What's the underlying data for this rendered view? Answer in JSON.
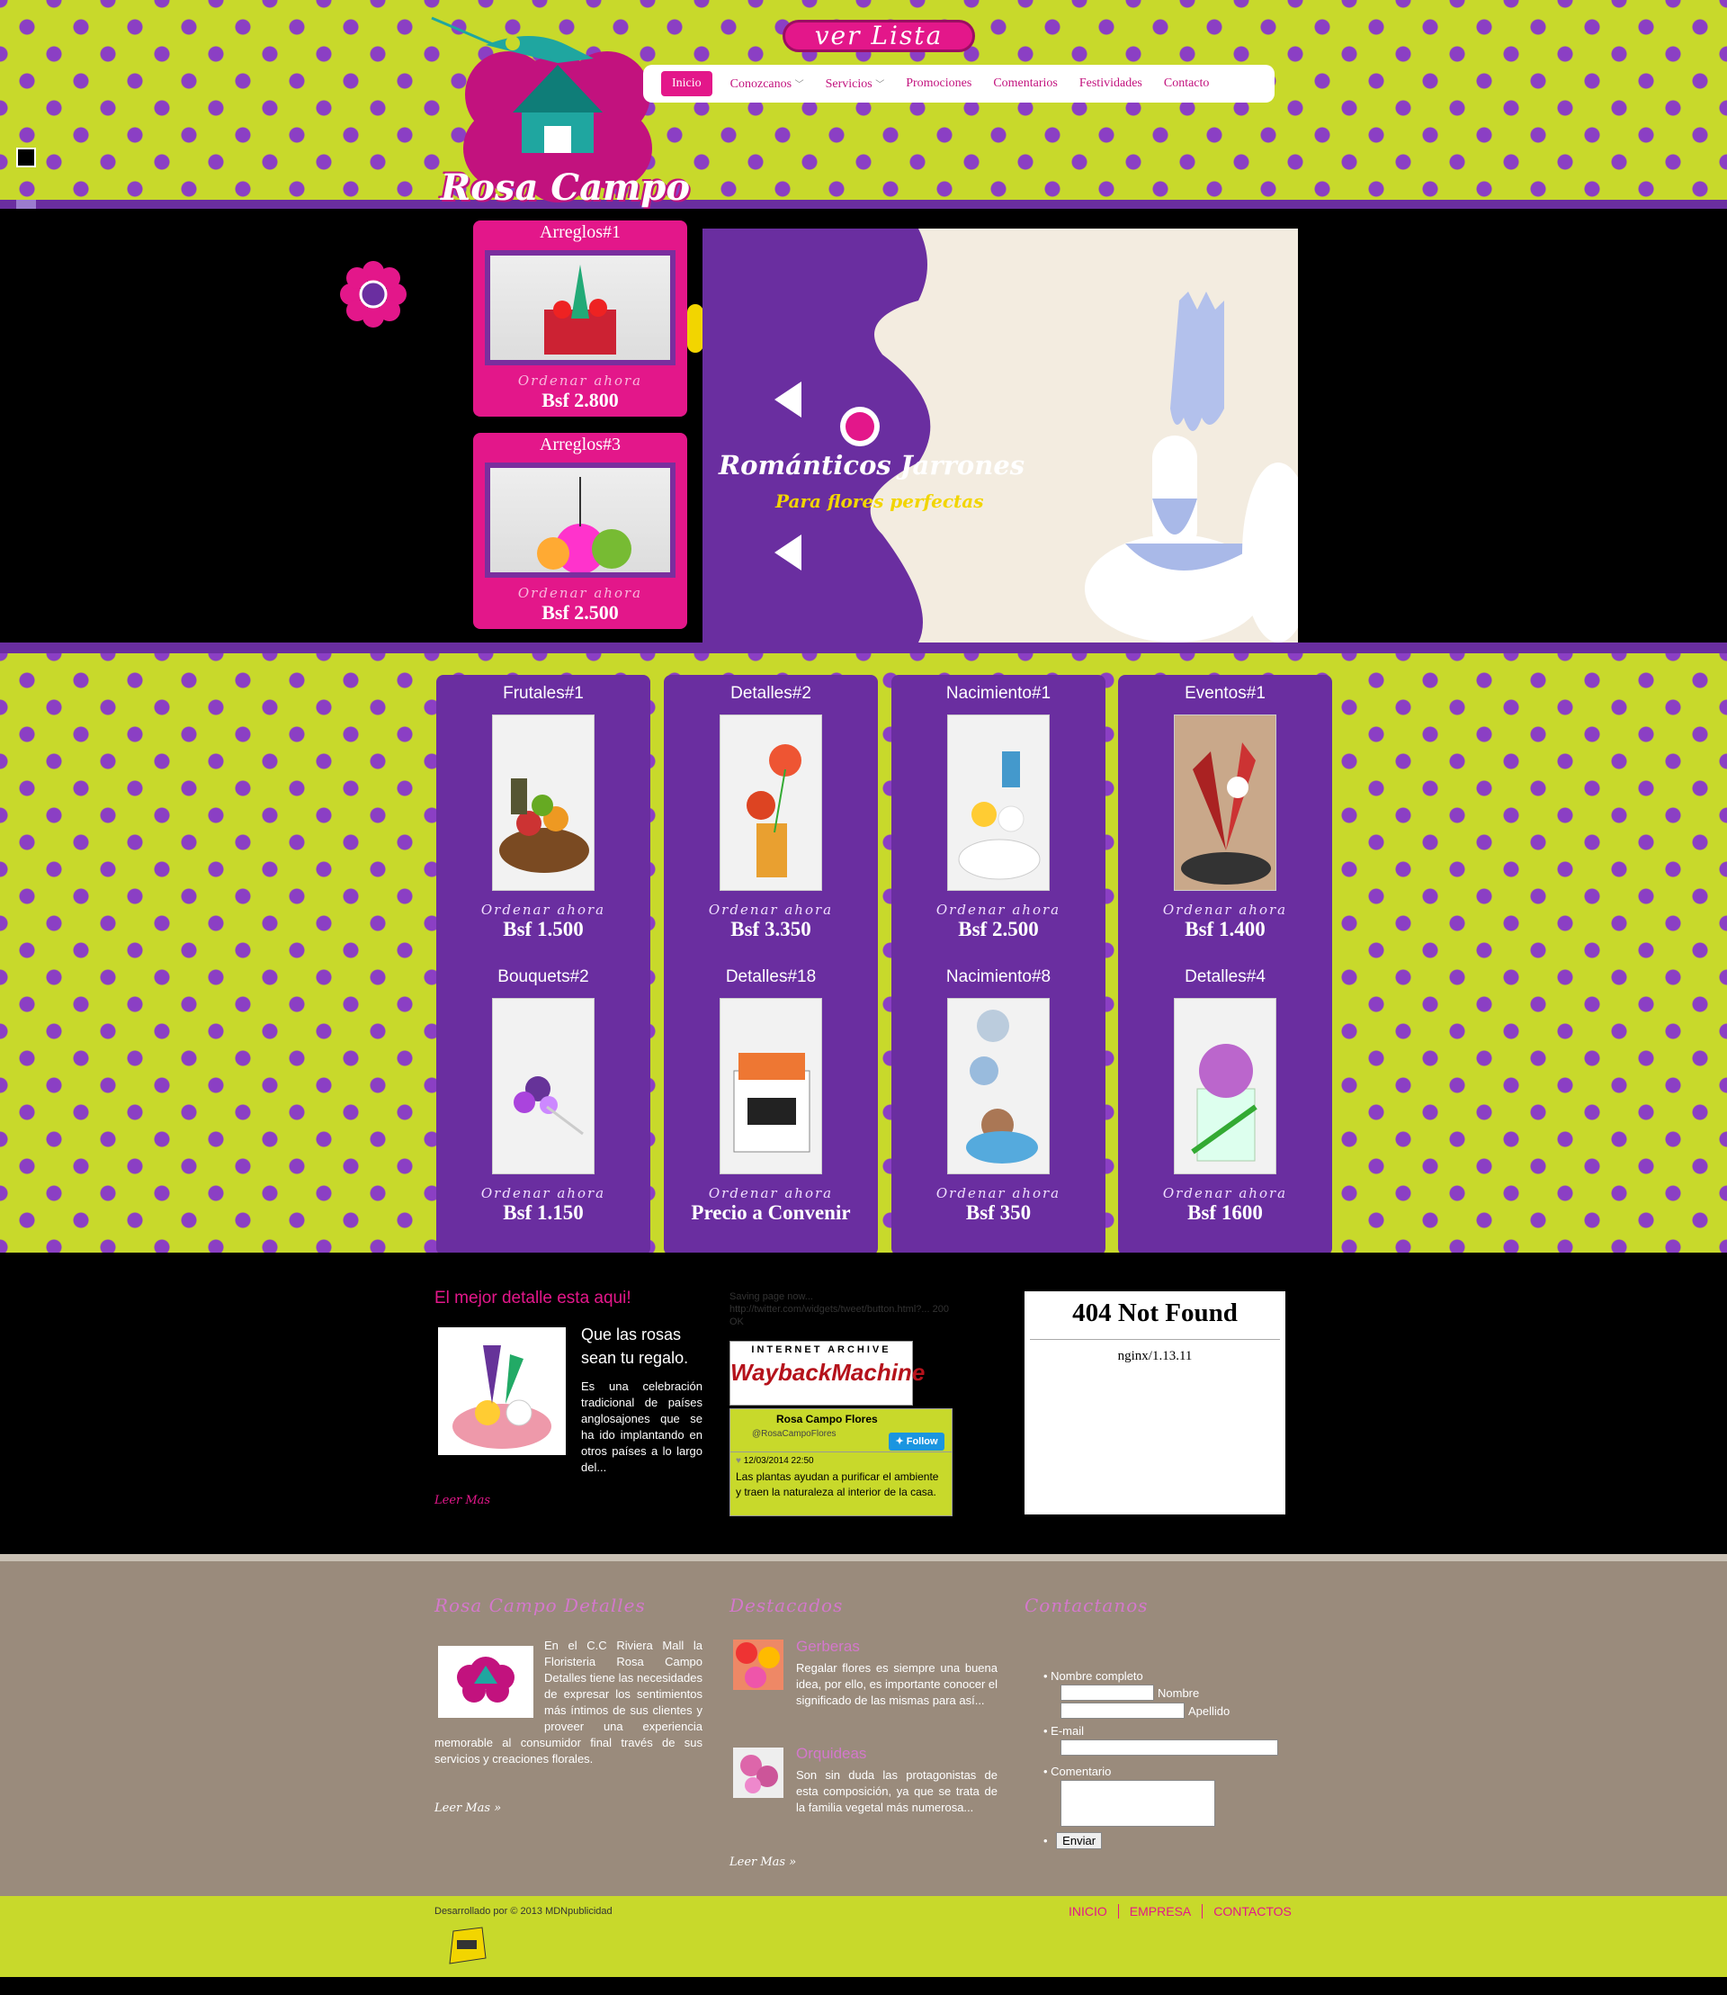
{
  "header": {
    "ver_lista": "ver Lista",
    "logo_text": "Rosa Campo",
    "nav": [
      "Inicio",
      "Conozcanos",
      "Servicios",
      "Promociones",
      "Comentarios",
      "Festividades",
      "Contacto"
    ]
  },
  "featured": [
    {
      "title": "Arreglos#1",
      "order": "Ordenar ahora",
      "price": "Bsf 2.800"
    },
    {
      "title": "Arreglos#3",
      "order": "Ordenar ahora",
      "price": "Bsf 2.500"
    }
  ],
  "slide": {
    "title": "Románticos Jarrones",
    "subtitle": "Para flores perfectas"
  },
  "products_row1": [
    {
      "title": "Frutales#1",
      "order": "Ordenar ahora",
      "price": "Bsf 1.500"
    },
    {
      "title": "Detalles#2",
      "order": "Ordenar ahora",
      "price": "Bsf 3.350"
    },
    {
      "title": "Nacimiento#1",
      "order": "Ordenar ahora",
      "price": "Bsf 2.500"
    },
    {
      "title": "Eventos#1",
      "order": "Ordenar ahora",
      "price": "Bsf 1.400"
    }
  ],
  "products_row2": [
    {
      "title": "Bouquets#2",
      "order": "Ordenar ahora",
      "price": "Bsf 1.150"
    },
    {
      "title": "Detalles#18",
      "order": "Ordenar ahora",
      "price": "Precio a Convenir"
    },
    {
      "title": "Nacimiento#8",
      "order": "Ordenar ahora",
      "price": "Bsf 350"
    },
    {
      "title": "Detalles#4",
      "order": "Ordenar ahora",
      "price": "Bsf 1600"
    }
  ],
  "blog": {
    "title": "El mejor detalle esta aqui!",
    "heading": "Que las rosas sean tu regalo.",
    "text": "Es una celebración tradicional de países anglosajones que se ha ido implantando en otros países a lo largo del...",
    "more": "Leer Mas"
  },
  "archive": {
    "saving": "Saving page now... http://twitter.com/widgets/tweet/button.html?... 200 OK",
    "wayback_top": "INTERNET ARCHIVE",
    "wayback_main": "WaybackMachine"
  },
  "twitter": {
    "name": "Rosa Campo Flores",
    "handle": "@RosaCampoFlores",
    "follow": "Follow",
    "date": "12/03/2014 22:50",
    "tweet": "Las plantas ayudan a purificar el ambiente y traen la naturaleza al interior de la casa."
  },
  "notfound": {
    "title": "404 Not Found",
    "server": "nginx/1.13.11"
  },
  "footer": {
    "col1_title": "Rosa Campo Detalles",
    "col1_text": "En el C.C Riviera Mall la Floristeria Rosa Campo Detalles tiene las necesidades de expresar los sentimientos más íntimos de sus clientes y proveer una experiencia memorable al consumidor final través de sus servicios y creaciones florales.",
    "col1_more": "Leer Mas »",
    "col2_title": "Destacados",
    "items": [
      {
        "title": "Gerberas",
        "text": "Regalar flores es siempre una buena idea, por ello, es importante conocer el significado de las mismas para así..."
      },
      {
        "title": "Orquideas",
        "text": "Son sin duda las protagonistas de esta composición, ya que se trata de la familia vegetal más numerosa..."
      }
    ],
    "col2_more": "Leer Mas »",
    "col3_title": "Contactanos",
    "form": {
      "name_label": "Nombre completo",
      "first": "Nombre",
      "last": "Apellido",
      "email": "E-mail",
      "comment": "Comentario",
      "submit": "Enviar"
    }
  },
  "bottom": {
    "credit": "Desarrollado por © 2013 MDNpublicidad",
    "links": [
      "INICIO",
      "EMPRESA",
      "CONTACTOS"
    ]
  },
  "colors": {
    "lime": "#c8d92b",
    "purple": "#6a2ea0",
    "magenta": "#e3178a"
  }
}
